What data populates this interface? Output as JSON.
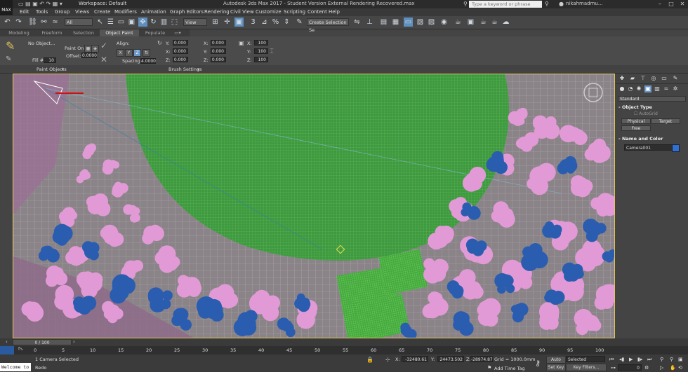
{
  "titlebar": {
    "logo": "MAX",
    "workspace": "Workspace: Default",
    "title": "Autodesk 3ds Max 2017 - Student Version    External Rendering Recovered.max",
    "search_placeholder": "Type a keyword or phrase",
    "user": "nikahmadmu..."
  },
  "menus": [
    "Edit",
    "Tools",
    "Group",
    "Views",
    "Create",
    "Modifiers",
    "Animation",
    "Graph Editors",
    "Rendering",
    "Civil View",
    "Customize",
    "Scripting",
    "Content",
    "Help"
  ],
  "toolbar": {
    "filter": "All",
    "ref_coord": "View",
    "named_selection": "Create Selection Se"
  },
  "ribbon": {
    "tabs": [
      "Modeling",
      "Freeform",
      "Selection",
      "Object Paint",
      "Populate"
    ],
    "active_tab": "Object Paint",
    "no_object": "No Object...",
    "paint_on": "Paint On:",
    "offset_label": "Offset:",
    "offset_value": "0.0000",
    "fill_label": "Fill #:",
    "fill_value": "10",
    "align_label": "Align:",
    "axes": [
      "X",
      "Y",
      "Z"
    ],
    "spacing_label": "Spacing:",
    "spacing_value": "4.0000",
    "rot_labels": [
      "Y:",
      "X:",
      "Z:"
    ],
    "rot_values": [
      "0.000",
      "0.000",
      "0.000"
    ],
    "pos_labels": [
      "X:",
      "Y:",
      "Z:"
    ],
    "pos_values": [
      "0.000",
      "0.000",
      "0.000"
    ],
    "scale_labels": [
      "X:",
      "Y:",
      "Z:"
    ],
    "scale_values": [
      "100",
      "100",
      "100"
    ],
    "paint_objects": "Paint Objects",
    "brush_settings": "Brush Settings"
  },
  "command_panel": {
    "dropdown": "Standard",
    "object_type_header": "Object Type",
    "autogrid": "AutoGrid",
    "buttons": [
      "Physical",
      "Target",
      "Free"
    ],
    "name_color_header": "Name and Color",
    "name_value": "Camera001",
    "swatch_color": "#2f6fd6"
  },
  "timeline": {
    "frame_display": "0 / 100",
    "ticks": [
      "0",
      "5",
      "10",
      "15",
      "20",
      "25",
      "30",
      "35",
      "40",
      "45",
      "50",
      "55",
      "60",
      "65",
      "70",
      "75",
      "80",
      "85",
      "90",
      "95",
      "100"
    ]
  },
  "status": {
    "maxscript": "Welcome to",
    "selection": "1 Camera Selected",
    "prompt": "Redo",
    "x_label": "X:",
    "x_value": "-32480.61",
    "y_label": "Y:",
    "y_value": "24473.502",
    "z_label": "Z:",
    "z_value": "-28974.87",
    "grid": "Grid = 1000.0mm",
    "add_time_tag": "Add Time Tag",
    "auto_key": "Auto Key",
    "set_key": "Set Key",
    "selected": "Selected",
    "key_filters": "Key Filters...",
    "frame": "0"
  },
  "colors": {
    "viewport_bg": "#9d7a9a",
    "grass": "#3e9a3e",
    "pink_tree": "#e29ad6",
    "blue_tree": "#2a5db0",
    "accent": "#6a98c8"
  }
}
